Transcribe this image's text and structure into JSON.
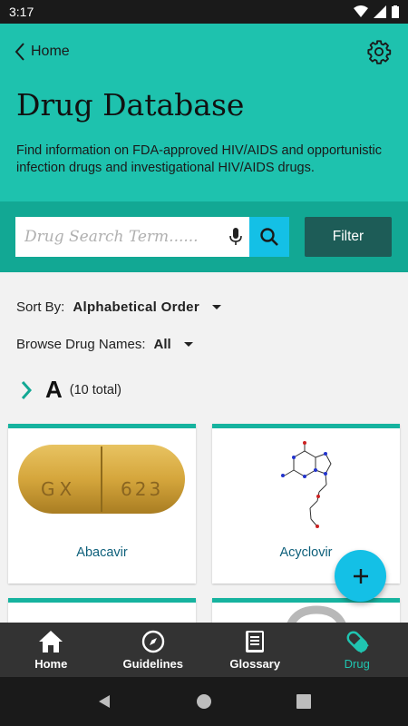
{
  "status_bar": {
    "time": "3:17"
  },
  "header": {
    "back_label": "Home",
    "title": "Drug Database",
    "description": "Find information on FDA-approved HIV/AIDS and opportunistic infection drugs and investigational HIV/AIDS drugs."
  },
  "search": {
    "placeholder": "Drug Search Term......",
    "filter_label": "Filter"
  },
  "sort": {
    "label": "Sort By:",
    "value": "Alphabetical Order"
  },
  "browse": {
    "label": "Browse Drug Names:",
    "value": "All"
  },
  "section": {
    "letter": "A",
    "count": "(10 total)"
  },
  "drugs": [
    {
      "name": "Abacavir",
      "imprint": "GX 623"
    },
    {
      "name": "Acyclovir"
    }
  ],
  "colors": {
    "primary": "#1ec2ae",
    "dark_teal": "#1d5c57",
    "accent": "#14c0e6",
    "nav_bg": "#333333"
  },
  "bottom_nav": [
    {
      "label": "Home",
      "icon": "home-icon"
    },
    {
      "label": "Guidelines",
      "icon": "compass-icon"
    },
    {
      "label": "Glossary",
      "icon": "book-icon"
    },
    {
      "label": "Drug",
      "icon": "pill-icon",
      "active": true
    }
  ]
}
